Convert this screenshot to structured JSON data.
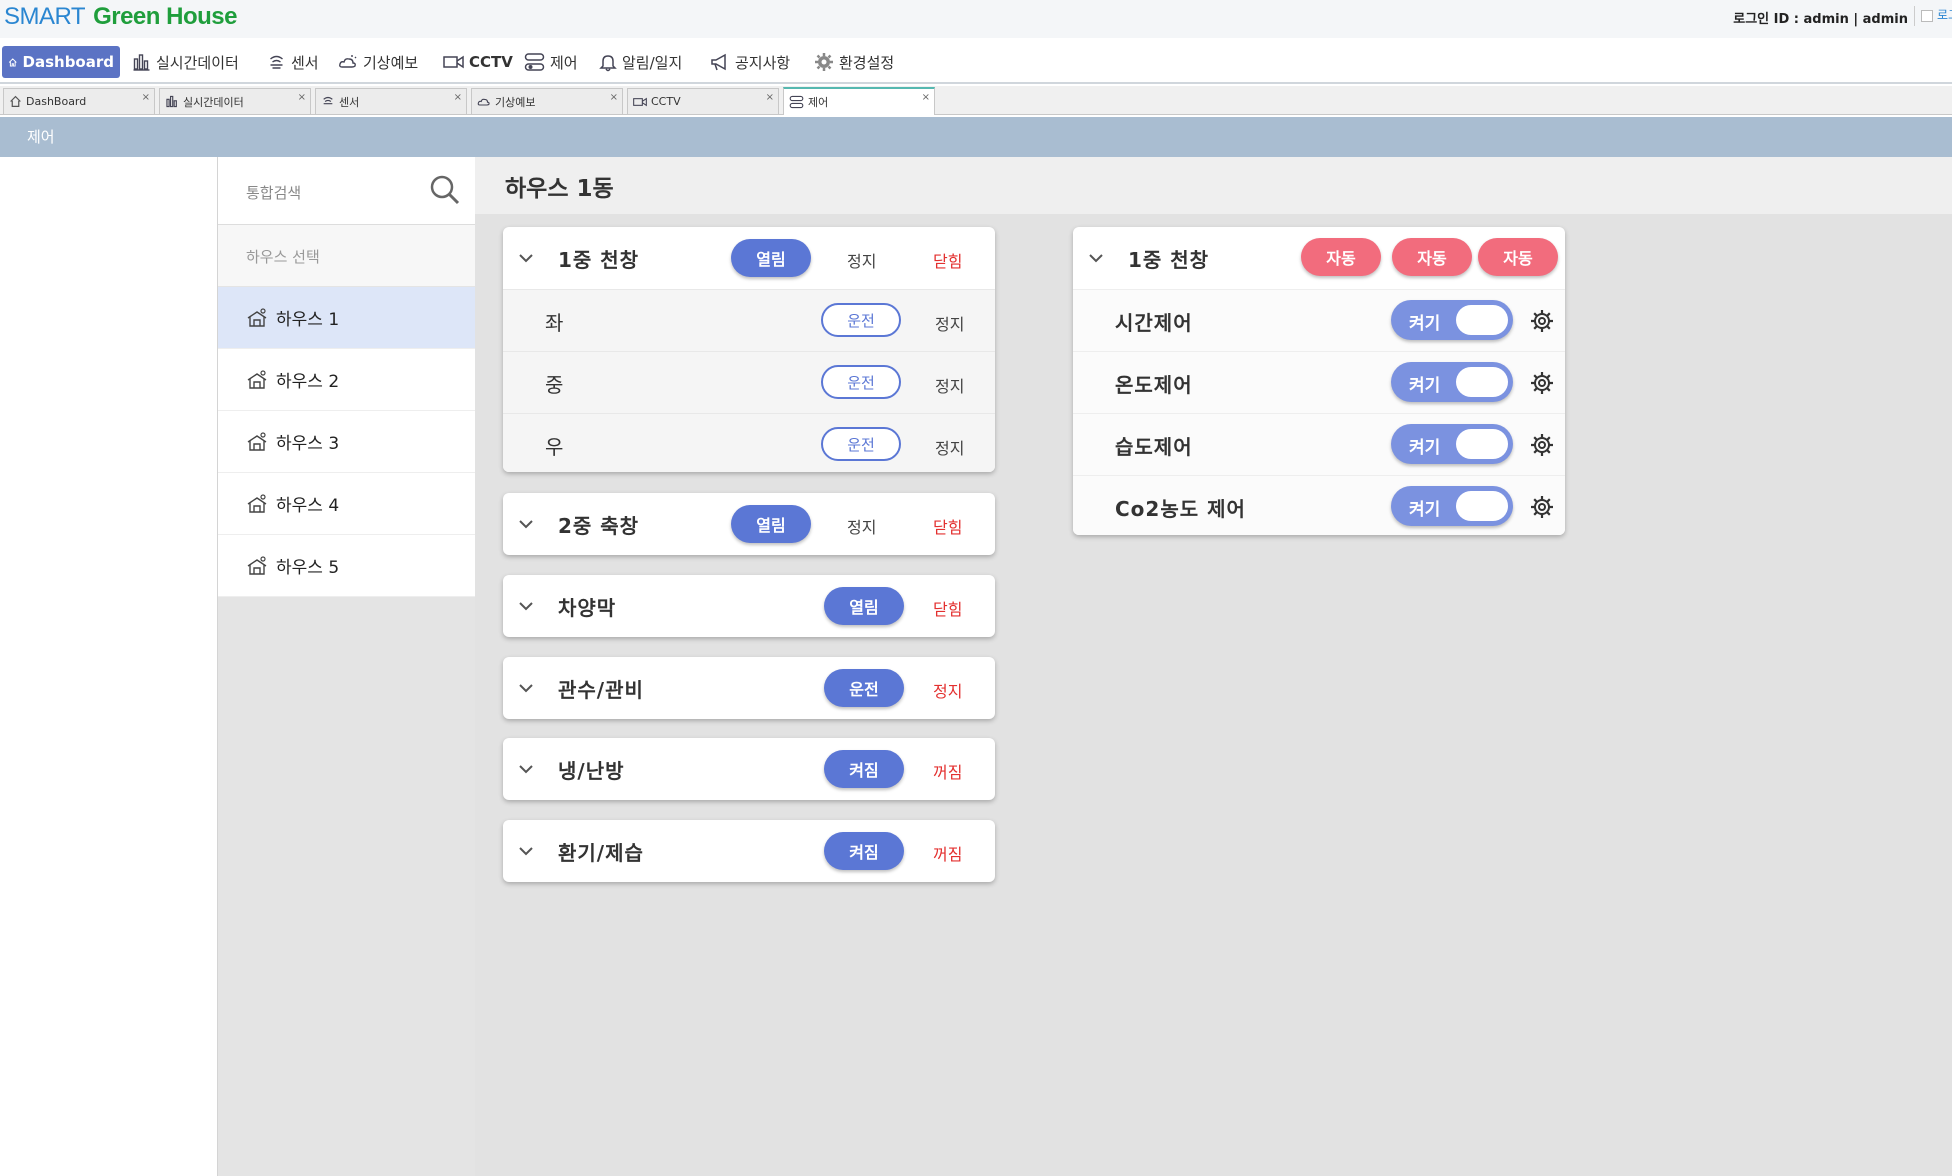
{
  "header": {
    "logo_smart": "SMART",
    "logo_green": "Green House",
    "login_info": "로그인 ID : admin | admin",
    "logout_partial": "로그"
  },
  "menu": {
    "items": [
      {
        "label": "Dashboard",
        "icon": "home-icon",
        "active": true
      },
      {
        "label": "실시간데이터",
        "icon": "bar-chart-icon"
      },
      {
        "label": "센서",
        "icon": "sensor-icon"
      },
      {
        "label": "기상예보",
        "icon": "weather-icon"
      },
      {
        "label": "CCTV",
        "icon": "camera-icon"
      },
      {
        "label": "제어",
        "icon": "control-icon"
      },
      {
        "label": "알림/일지",
        "icon": "bell-icon"
      },
      {
        "label": "공지사항",
        "icon": "megaphone-icon"
      },
      {
        "label": "환경설정",
        "icon": "gear-icon"
      }
    ]
  },
  "tabs": [
    {
      "label": "DashBoard"
    },
    {
      "label": "실시간데이터"
    },
    {
      "label": "센서"
    },
    {
      "label": "기상예보"
    },
    {
      "label": "CCTV"
    },
    {
      "label": "제어",
      "active": true
    }
  ],
  "page_title": "제어",
  "sidebar": {
    "search_placeholder": "통합검색",
    "house_select_label": "하우스 선택",
    "houses": [
      "하우스 1",
      "하우스 2",
      "하우스 3",
      "하우스 4",
      "하우스 5"
    ],
    "selected_index": 0
  },
  "main": {
    "title": "하우스 1동",
    "cards": [
      {
        "title": "1중 천창",
        "buttons": [
          "열림",
          "정지",
          "닫힘"
        ],
        "rows": [
          {
            "label": "좌",
            "run": "운전",
            "stop": "정지"
          },
          {
            "label": "중",
            "run": "운전",
            "stop": "정지"
          },
          {
            "label": "우",
            "run": "운전",
            "stop": "정지"
          }
        ]
      },
      {
        "title": "2중 축창",
        "buttons": [
          "열림",
          "정지",
          "닫힘"
        ]
      },
      {
        "title": "차양막",
        "buttons": [
          "열림",
          "닫힘"
        ]
      },
      {
        "title": "관수/관비",
        "buttons": [
          "운전",
          "정지"
        ]
      },
      {
        "title": "냉/난방",
        "buttons": [
          "켜짐",
          "꺼짐"
        ]
      },
      {
        "title": "환기/제습",
        "buttons": [
          "켜짐",
          "꺼짐"
        ]
      }
    ],
    "auto_card": {
      "title": "1중 천창",
      "auto_buttons": [
        "자동",
        "자동",
        "자동"
      ],
      "controls": [
        {
          "label": "시간제어",
          "toggle": "켜기"
        },
        {
          "label": "온도제어",
          "toggle": "켜기"
        },
        {
          "label": "습도제어",
          "toggle": "켜기"
        },
        {
          "label": "Co2농도 제어",
          "toggle": "켜기"
        }
      ]
    }
  },
  "colors": {
    "primary": "#5b77d5",
    "danger_text": "#e3302f",
    "auto_pill": "#f26c7d",
    "title_bar": "#a9bdd1"
  }
}
